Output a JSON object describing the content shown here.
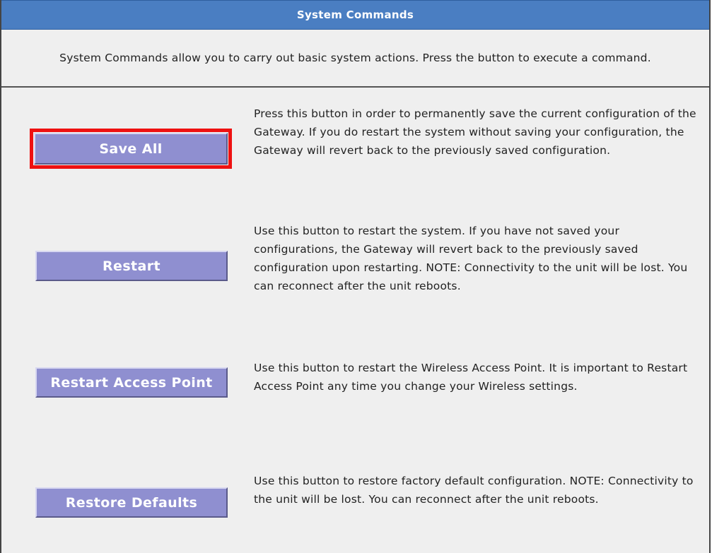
{
  "header": {
    "title": "System Commands"
  },
  "intro": {
    "text": "System Commands allow you to carry out basic system actions. Press the button to execute a command."
  },
  "commands": [
    {
      "label": "Save All",
      "description": "Press this button in order to permanently save the current configuration of the Gateway. If you do restart the system without saving your configuration, the Gateway will revert back to the previously saved configuration.",
      "highlighted": true
    },
    {
      "label": "Restart",
      "description": "Use this button to restart the system. If you have not saved your configurations, the Gateway will revert back to the previously saved configuration upon restarting. NOTE: Connectivity to the unit will be lost. You can reconnect after the unit reboots."
    },
    {
      "label": "Restart Access Point",
      "description": "Use this button to restart the Wireless Access Point. It is important to Restart Access Point any time you change your Wireless settings."
    },
    {
      "label": "Restore Defaults",
      "description": "Use this button to restore factory default configuration. NOTE: Connectivity to the unit will be lost. You can reconnect after the unit reboots."
    }
  ],
  "colors": {
    "title_bar": "#4a7ec2",
    "button": "#8f8fd0",
    "highlight": "#ee1111",
    "panel_bg": "#efefef"
  }
}
